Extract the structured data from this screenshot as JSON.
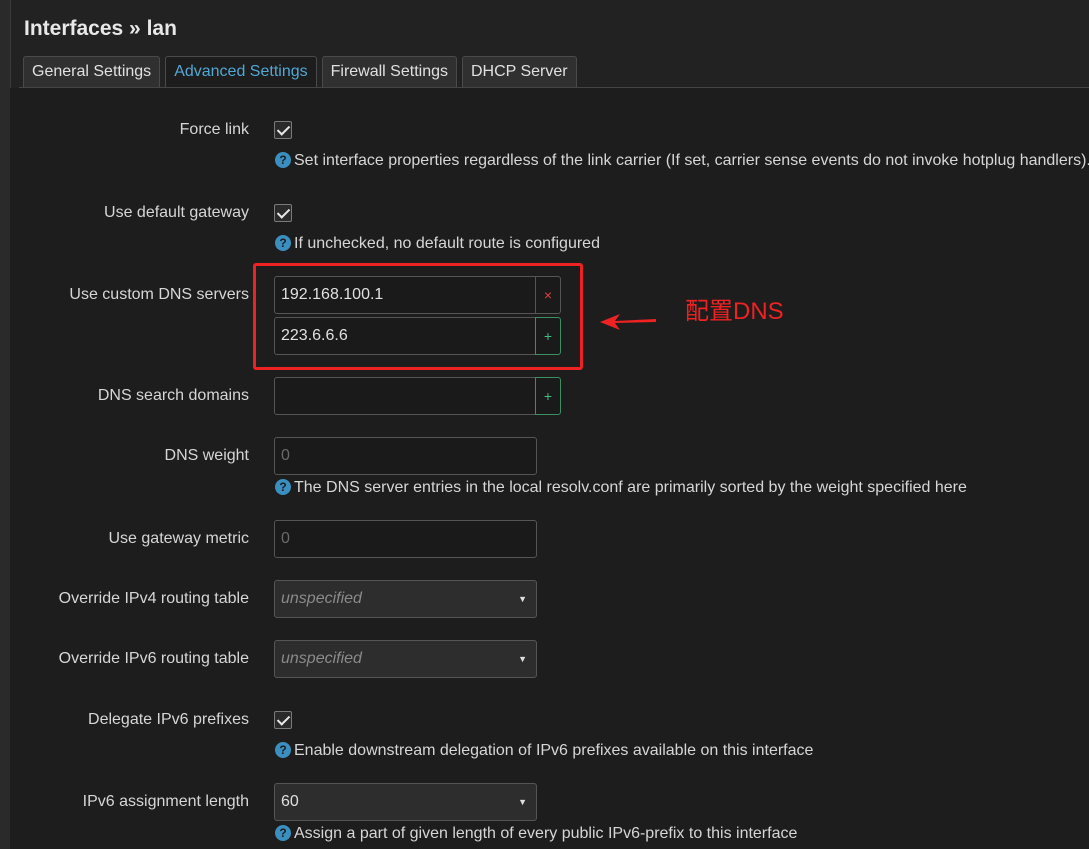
{
  "header": {
    "title": "Interfaces » lan"
  },
  "tabs": [
    {
      "label": "General Settings",
      "active": false
    },
    {
      "label": "Advanced Settings",
      "active": true
    },
    {
      "label": "Firewall Settings",
      "active": false
    },
    {
      "label": "DHCP Server",
      "active": false
    }
  ],
  "fields": {
    "force_link": {
      "label": "Force link",
      "checked": true,
      "help": "Set interface properties regardless of the link carrier (If set, carrier sense events do not invoke hotplug handlers)."
    },
    "default_gateway": {
      "label": "Use default gateway",
      "checked": true,
      "help": "If unchecked, no default route is configured"
    },
    "custom_dns": {
      "label": "Use custom DNS servers",
      "entries": [
        "192.168.100.1",
        "223.6.6.6"
      ],
      "remove_symbol": "×",
      "add_symbol": "+"
    },
    "dns_search": {
      "label": "DNS search domains",
      "value": "",
      "add_symbol": "+"
    },
    "dns_weight": {
      "label": "DNS weight",
      "placeholder": "0",
      "help": "The DNS server entries in the local resolv.conf are primarily sorted by the weight specified here"
    },
    "gateway_metric": {
      "label": "Use gateway metric",
      "placeholder": "0"
    },
    "ipv4_table": {
      "label": "Override IPv4 routing table",
      "value": "unspecified"
    },
    "ipv6_table": {
      "label": "Override IPv6 routing table",
      "value": "unspecified"
    },
    "delegate_ipv6": {
      "label": "Delegate IPv6 prefixes",
      "checked": true,
      "help": "Enable downstream delegation of IPv6 prefixes available on this interface"
    },
    "ipv6_assign": {
      "label": "IPv6 assignment length",
      "value": "60",
      "help": "Assign a part of given length of every public IPv6-prefix to this interface"
    }
  },
  "annotation": {
    "text": "配置DNS",
    "color": "#ee2222"
  },
  "colors": {
    "background": "#1d1d1d",
    "accent": "#4fa8d6",
    "help_icon": "#3a8fc0",
    "remove": "#e04040",
    "add": "#3fbf7f"
  },
  "icons": {
    "help": "question-circle-icon",
    "check": "check-icon",
    "chevron": "chevron-down-icon",
    "arrow": "arrow-left-icon"
  },
  "glyphs": {
    "help": "?",
    "chevron": "▼"
  }
}
